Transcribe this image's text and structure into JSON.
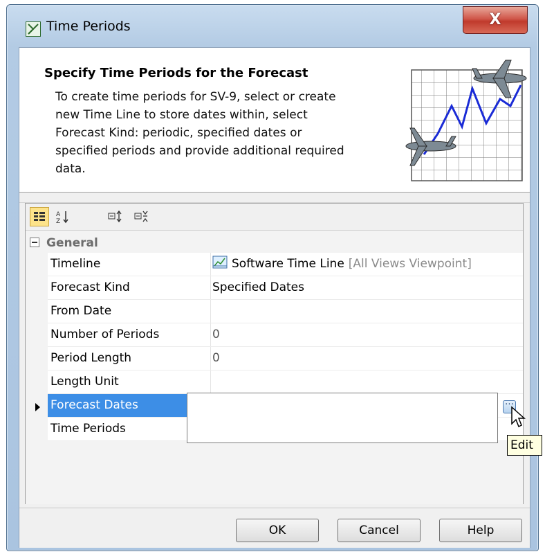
{
  "window": {
    "title": "Time Periods",
    "app_icon": "time-periods-icon",
    "close_symbol": "X"
  },
  "header": {
    "title": "Specify Time Periods for the Forecast",
    "description": "To create time periods for SV-9, select or create\nnew Time Line to store dates within, select\nForecast Kind: periodic, specified dates or\nspecified periods and provide additional required\ndata.",
    "art_icon": "forecast-chart-airplanes-icon"
  },
  "toolbar": {
    "buttons": [
      {
        "icon": "categorized-view-icon",
        "active": true
      },
      {
        "icon": "sort-alphabetically-icon",
        "active": false
      },
      {
        "icon": "expand-all-icon",
        "active": false
      },
      {
        "icon": "collapse-all-icon",
        "active": false
      }
    ]
  },
  "properties": {
    "group": "General",
    "rows": [
      {
        "name": "Timeline",
        "value": "Software Time Line",
        "qualifier": "[All Views Viewpoint]"
      },
      {
        "name": "Forecast Kind",
        "value": "Specified Dates"
      },
      {
        "name": "From Date",
        "value": ""
      },
      {
        "name": "Number of Periods",
        "value": "0"
      },
      {
        "name": "Period Length",
        "value": "0"
      },
      {
        "name": "Length Unit",
        "value": ""
      },
      {
        "name": "Forecast Dates",
        "value": ""
      },
      {
        "name": "Time Periods",
        "value": ""
      }
    ]
  },
  "edit_tooltip": "Edit",
  "buttons": {
    "ok": "OK",
    "cancel": "Cancel",
    "help": "Help"
  },
  "colors": {
    "selection": "#3d8ee6",
    "close_button": "#c03a2c",
    "tooltip_bg": "#ffffe1"
  }
}
